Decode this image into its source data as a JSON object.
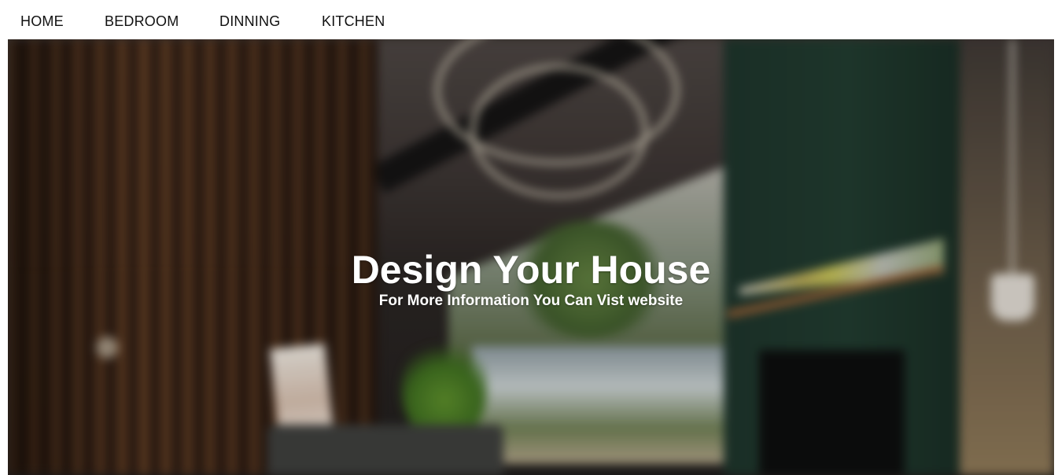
{
  "nav": {
    "items": [
      {
        "label": "HOME"
      },
      {
        "label": "BEDROOM"
      },
      {
        "label": "DINNING"
      },
      {
        "label": "KITCHEN"
      }
    ]
  },
  "hero": {
    "title": "Design Your House",
    "subtitle": "For More Information You Can Vist website"
  },
  "colors": {
    "nav_background": "#ffffff",
    "nav_text": "#111111",
    "hero_text": "#ffffff"
  }
}
